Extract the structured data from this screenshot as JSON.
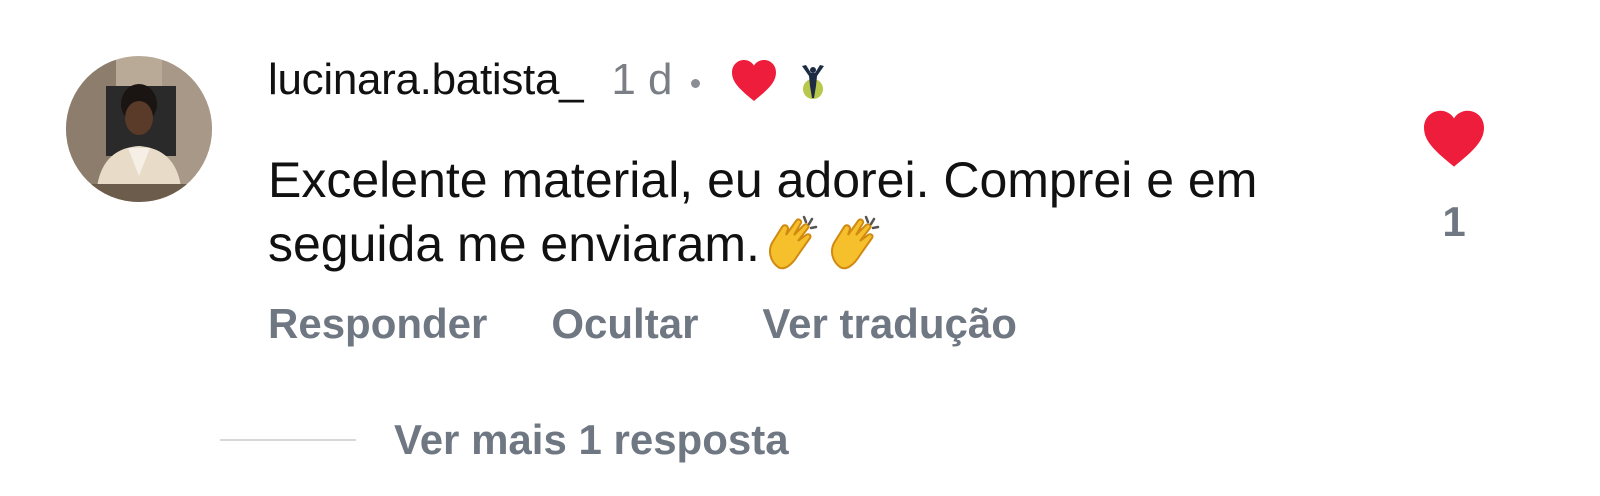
{
  "comment": {
    "username": "lucinara.batista_",
    "time": "1 d",
    "text": "Excelente material, eu adorei. Comprei e em seguida me enviaram.",
    "emojis": [
      "clapping-hands-icon",
      "clapping-hands-icon"
    ],
    "liked_by_author_icon": "heart-icon",
    "badge_icon": "trophy-figure-icon",
    "like_count": "1",
    "liked": true
  },
  "actions": {
    "reply": "Responder",
    "hide": "Ocultar",
    "translate": "Ver tradução"
  },
  "replies": {
    "view_more": "Ver mais 1 resposta"
  },
  "colors": {
    "heart": "#ee1d3b",
    "muted_text": "#6f7782",
    "timestamp": "#7b7f85"
  }
}
